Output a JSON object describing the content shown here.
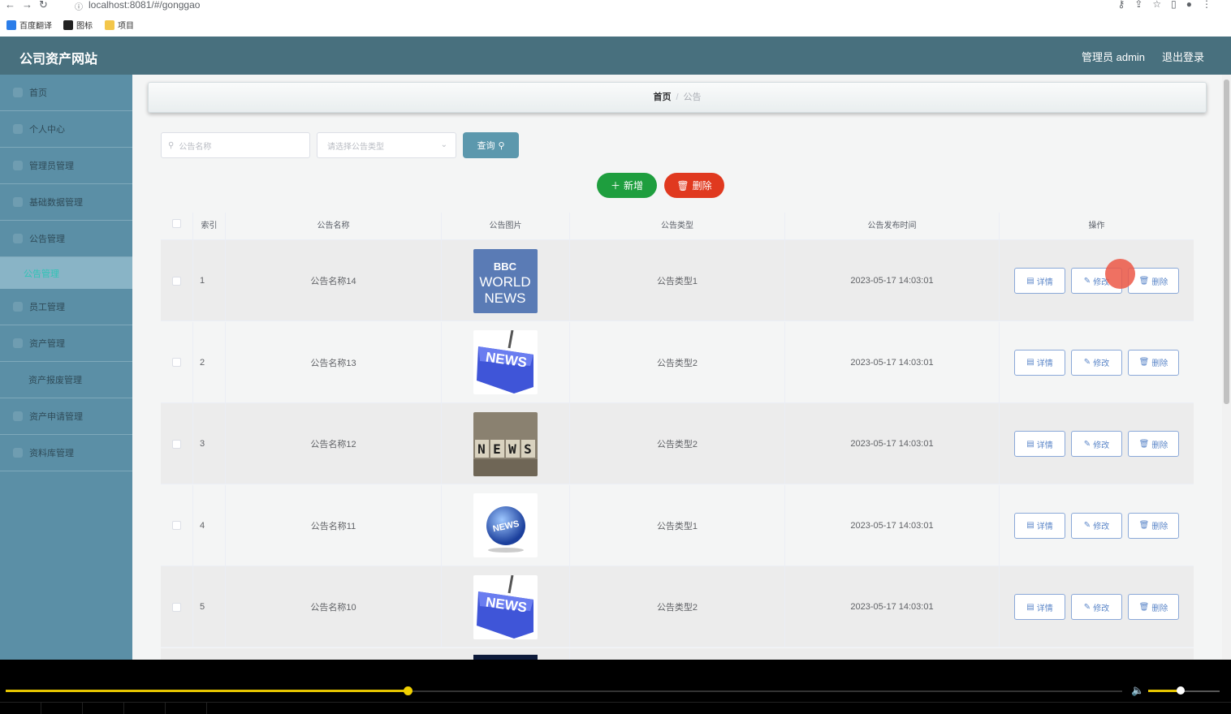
{
  "browser": {
    "url": "localhost:8081/#/gonggao",
    "bookmarks": [
      "百度翻译",
      "图标",
      "项目"
    ]
  },
  "header": {
    "title": "公司资产网站",
    "user": "管理员 admin",
    "logout": "退出登录"
  },
  "sidebar": {
    "items": [
      {
        "label": "首页"
      },
      {
        "label": "个人中心"
      },
      {
        "label": "管理员管理"
      },
      {
        "label": "基础数据管理"
      },
      {
        "label": "公告管理"
      },
      {
        "label": "员工管理"
      },
      {
        "label": "资产管理"
      },
      {
        "label": "资产报废管理"
      },
      {
        "label": "资产申请管理"
      },
      {
        "label": "资料库管理"
      }
    ],
    "active_sub": "公告管理"
  },
  "breadcrumb": {
    "home": "首页",
    "current": "公告"
  },
  "search": {
    "name_placeholder": "公告名称",
    "type_placeholder": "请选择公告类型",
    "query_label": "查询"
  },
  "actions": {
    "add_label": "新增",
    "delete_label": "删除"
  },
  "table": {
    "headers": [
      "索引",
      "公告名称",
      "公告图片",
      "公告类型",
      "公告发布时间",
      "操作"
    ],
    "rows": [
      {
        "index": "1",
        "name": "公告名称14",
        "image": "bbc-world-news",
        "type": "公告类型1",
        "time": "2023-05-17 14:03:01"
      },
      {
        "index": "2",
        "name": "公告名称13",
        "image": "news-key",
        "type": "公告类型2",
        "time": "2023-05-17 14:03:01"
      },
      {
        "index": "3",
        "name": "公告名称12",
        "image": "news-blocks",
        "type": "公告类型2",
        "time": "2023-05-17 14:03:01"
      },
      {
        "index": "4",
        "name": "公告名称11",
        "image": "news-globe",
        "type": "公告类型1",
        "time": "2023-05-17 14:03:01"
      },
      {
        "index": "5",
        "name": "公告名称10",
        "image": "news-key",
        "type": "公告类型2",
        "time": "2023-05-17 14:03:01"
      }
    ],
    "row_buttons": {
      "detail": "详情",
      "edit": "修改",
      "delete": "删除"
    }
  },
  "image_text": {
    "bbc_logo": "BBC",
    "bbc_line1": "WORLD",
    "bbc_line2": "NEWS",
    "key": "NEWS",
    "blocks": [
      "N",
      "E",
      "W",
      "S"
    ],
    "globe": "NEWS"
  },
  "player": {
    "progress": 0.36,
    "volume": 0.45
  },
  "colors": {
    "header_bg": "#48707e",
    "sidebar_bg": "#5b8fa6",
    "query_btn": "#5c98ad",
    "add_btn": "#1e9e3e",
    "delete_btn": "#e0391f",
    "row_btn_border": "#8aa8d8"
  }
}
